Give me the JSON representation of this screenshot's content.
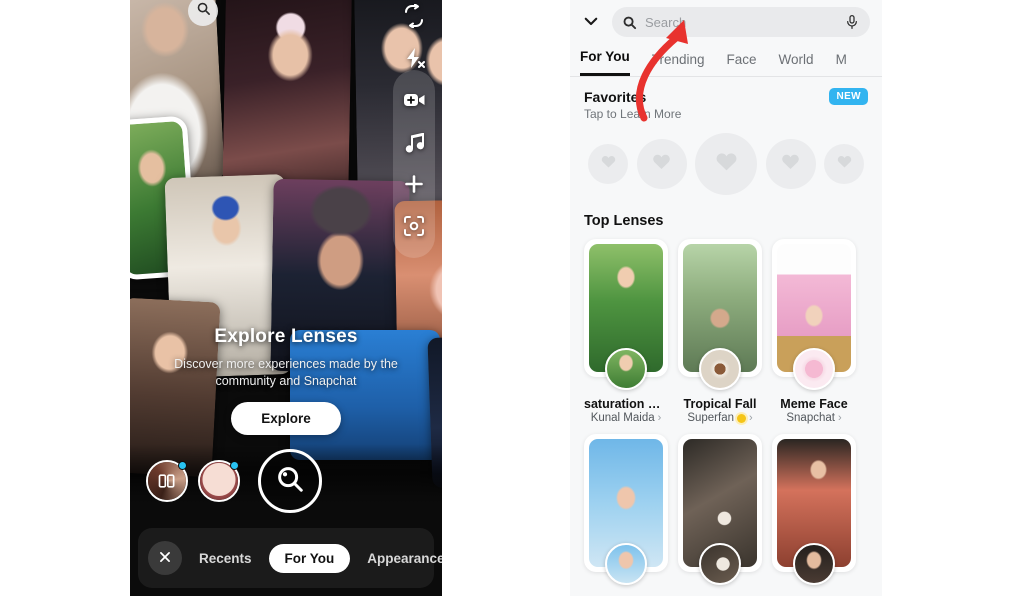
{
  "left_phone": {
    "search_bubble_icon": "search-icon",
    "tool_rail": [
      {
        "name": "flip-camera-icon",
        "label": "Flip camera"
      },
      {
        "name": "flash-off-icon",
        "label": "Flash off"
      },
      {
        "name": "camera-add-icon",
        "label": "Add camera"
      },
      {
        "name": "music-note-icon",
        "label": "Music"
      },
      {
        "name": "plus-icon",
        "label": "Add"
      },
      {
        "name": "scan-icon",
        "label": "Scan"
      }
    ],
    "explore": {
      "title": "Explore Lenses",
      "subtitle": "Discover more experiences made by the community and Snapchat",
      "button_label": "Explore"
    },
    "carousel": {
      "thumb1_icon": "cards-icon",
      "thumb2_icon": "face-lens-icon",
      "search_lens_icon": "search-lens-icon"
    },
    "bottom_bar": {
      "close_icon": "close-icon",
      "tabs": [
        {
          "label": "Recents",
          "active": false
        },
        {
          "label": "For You",
          "active": true
        },
        {
          "label": "Appearance",
          "active": false
        }
      ],
      "magic_icon": "magic-sparkle-icon"
    }
  },
  "right_panel": {
    "search": {
      "chevron_icon": "chevron-down-icon",
      "search_icon": "search-icon",
      "placeholder": "Search",
      "value": "",
      "mic_icon": "microphone-icon"
    },
    "tabs": [
      {
        "label": "For You",
        "active": true
      },
      {
        "label": "Trending",
        "active": false
      },
      {
        "label": "Face",
        "active": false
      },
      {
        "label": "World",
        "active": false
      },
      {
        "label": "M",
        "active": false
      }
    ],
    "favorites": {
      "title": "Favorites",
      "subtitle": "Tap to Learn More",
      "badge": "NEW",
      "badge_color": "#32b4f0",
      "placeholder_count": 5,
      "placeholder_icon": "heart-icon"
    },
    "top_lenses": {
      "title": "Top Lenses",
      "row1": [
        {
          "name": "saturation n f...",
          "author": "Kunal Maida",
          "has_sun": false
        },
        {
          "name": "Tropical Fall",
          "author": "Superfan",
          "has_sun": true
        },
        {
          "name": "Meme Face",
          "author": "Snapchat",
          "has_sun": false
        }
      ],
      "row2": [
        {
          "name": "",
          "author": ""
        },
        {
          "name": "",
          "author": ""
        },
        {
          "name": "",
          "author": ""
        }
      ]
    }
  },
  "annotations": {
    "arrow_color": "#e8322e",
    "left_arrow_points_to": "Explore",
    "right_arrow_points_to": "Search"
  }
}
